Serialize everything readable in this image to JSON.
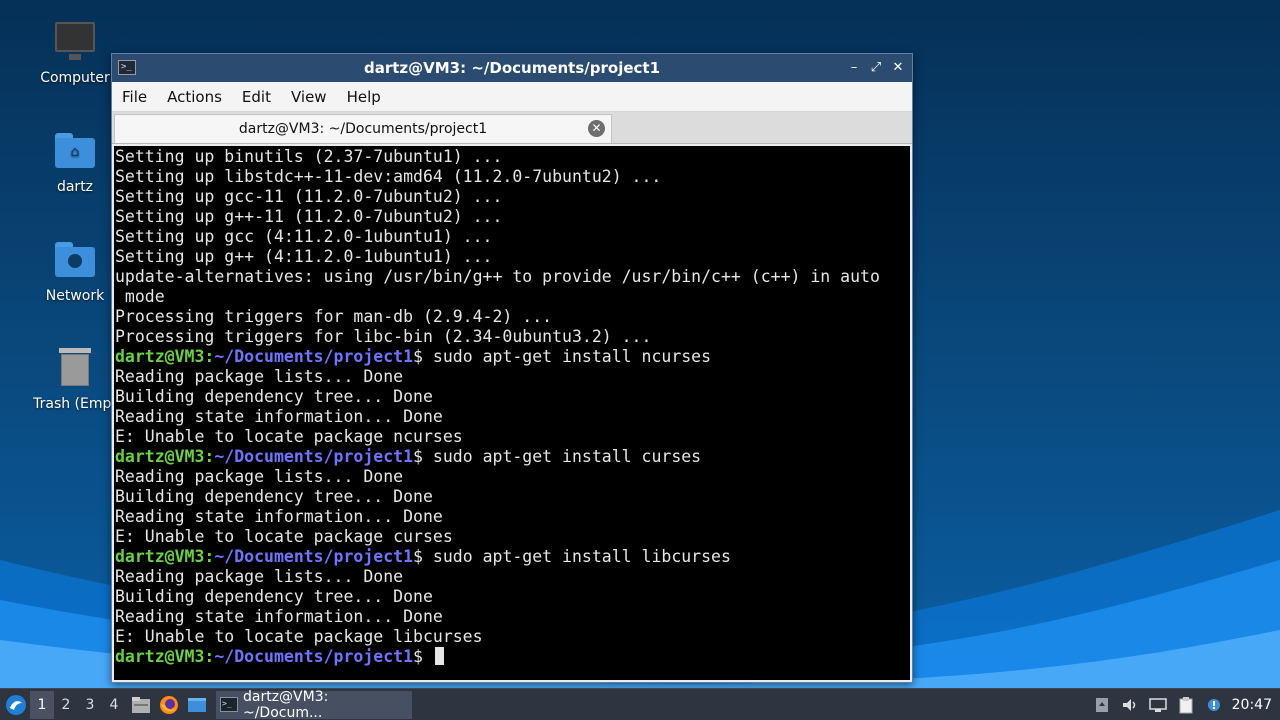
{
  "desktop": {
    "icons": [
      {
        "label": "Computer",
        "icon": "monitor-icon"
      },
      {
        "label": "dartz",
        "icon": "home-folder-icon"
      },
      {
        "label": "Network",
        "icon": "network-folder-icon"
      },
      {
        "label": "Trash (Empt",
        "icon": "trash-icon"
      }
    ]
  },
  "window": {
    "title": "dartz@VM3: ~/Documents/project1",
    "controls": {
      "minimize": "–",
      "maximize": "⤢",
      "close": "✕"
    },
    "menu": [
      "File",
      "Actions",
      "Edit",
      "View",
      "Help"
    ],
    "tab": {
      "label": "dartz@VM3: ~/Documents/project1",
      "close": "✕"
    }
  },
  "terminal": {
    "prompt_user": "dartz@VM3",
    "prompt_sep": ":",
    "prompt_path": "~/Documents/project1",
    "prompt_dollar": "$",
    "lines": [
      {
        "t": "out",
        "text": "Setting up binutils (2.37-7ubuntu1) ..."
      },
      {
        "t": "out",
        "text": "Setting up libstdc++-11-dev:amd64 (11.2.0-7ubuntu2) ..."
      },
      {
        "t": "out",
        "text": "Setting up gcc-11 (11.2.0-7ubuntu2) ..."
      },
      {
        "t": "out",
        "text": "Setting up g++-11 (11.2.0-7ubuntu2) ..."
      },
      {
        "t": "out",
        "text": "Setting up gcc (4:11.2.0-1ubuntu1) ..."
      },
      {
        "t": "out",
        "text": "Setting up g++ (4:11.2.0-1ubuntu1) ..."
      },
      {
        "t": "out",
        "text": "update-alternatives: using /usr/bin/g++ to provide /usr/bin/c++ (c++) in auto"
      },
      {
        "t": "out",
        "text": " mode"
      },
      {
        "t": "out",
        "text": "Processing triggers for man-db (2.9.4-2) ..."
      },
      {
        "t": "out",
        "text": "Processing triggers for libc-bin (2.34-0ubuntu3.2) ..."
      },
      {
        "t": "cmd",
        "text": " sudo apt-get install ncurses"
      },
      {
        "t": "out",
        "text": "Reading package lists... Done"
      },
      {
        "t": "out",
        "text": "Building dependency tree... Done"
      },
      {
        "t": "out",
        "text": "Reading state information... Done"
      },
      {
        "t": "out",
        "text": "E: Unable to locate package ncurses"
      },
      {
        "t": "cmd",
        "text": " sudo apt-get install curses"
      },
      {
        "t": "out",
        "text": "Reading package lists... Done"
      },
      {
        "t": "out",
        "text": "Building dependency tree... Done"
      },
      {
        "t": "out",
        "text": "Reading state information... Done"
      },
      {
        "t": "out",
        "text": "E: Unable to locate package curses"
      },
      {
        "t": "cmd",
        "text": " sudo apt-get install libcurses"
      },
      {
        "t": "out",
        "text": "Reading package lists... Done"
      },
      {
        "t": "out",
        "text": "Building dependency tree... Done"
      },
      {
        "t": "out",
        "text": "Reading state information... Done"
      },
      {
        "t": "out",
        "text": "E: Unable to locate package libcurses"
      },
      {
        "t": "cmd",
        "text": " "
      }
    ]
  },
  "taskbar": {
    "workspaces": [
      "1",
      "2",
      "3",
      "4"
    ],
    "active_workspace": "1",
    "task_label": "dartz@VM3: ~/Docum...",
    "clock": "20:47"
  },
  "colors": {
    "prompt_user": "#6ad145",
    "prompt_path": "#6f74ff",
    "titlebar": "#2b4c70"
  }
}
